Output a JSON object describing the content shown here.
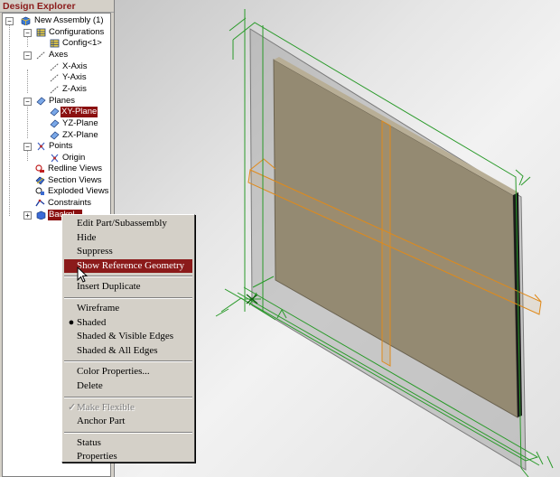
{
  "explorer": {
    "title": "Design Explorer",
    "tree": [
      {
        "label": "New Assembly (1)",
        "icon": "assembly-icon",
        "expander": "−",
        "selected": false
      },
      {
        "label": "Configurations",
        "icon": "configurations-icon",
        "expander": "−",
        "selected": false
      },
      {
        "label": "Config<1>",
        "icon": "config-icon",
        "selected": false
      },
      {
        "label": "Axes",
        "icon": "axes-icon",
        "expander": "−",
        "selected": false
      },
      {
        "label": "X-Axis",
        "icon": "axis-icon",
        "selected": false
      },
      {
        "label": "Y-Axis",
        "icon": "axis-icon",
        "selected": false
      },
      {
        "label": "Z-Axis",
        "icon": "axis-icon",
        "selected": false
      },
      {
        "label": "Planes",
        "icon": "planes-icon",
        "expander": "−",
        "selected": false
      },
      {
        "label": "XY-Plane",
        "icon": "plane-icon",
        "selected": true
      },
      {
        "label": "YZ-Plane",
        "icon": "plane-icon",
        "selected": false
      },
      {
        "label": "ZX-Plane",
        "icon": "plane-icon",
        "selected": false
      },
      {
        "label": "Points",
        "icon": "points-icon",
        "expander": "−",
        "selected": false
      },
      {
        "label": "Origin",
        "icon": "origin-icon",
        "selected": false
      },
      {
        "label": "Redline Views",
        "icon": "redline-views-icon",
        "selected": false
      },
      {
        "label": "Section Views",
        "icon": "section-views-icon",
        "selected": false
      },
      {
        "label": "Exploded Views",
        "icon": "exploded-views-icon",
        "selected": false
      },
      {
        "label": "Constraints",
        "icon": "constraints-icon",
        "selected": false
      },
      {
        "label": "Backpl...",
        "icon": "part-icon",
        "expander": "+",
        "selected": true
      }
    ]
  },
  "context_menu": {
    "items": [
      {
        "type": "item",
        "label": "Edit Part/Subassembly"
      },
      {
        "type": "item",
        "label": "Hide"
      },
      {
        "type": "item",
        "label": "Suppress"
      },
      {
        "type": "item",
        "label": "Show Reference Geometry",
        "highlighted": true
      },
      {
        "type": "separator"
      },
      {
        "type": "item",
        "label": "Insert Duplicate"
      },
      {
        "type": "separator"
      },
      {
        "type": "item",
        "label": "Wireframe"
      },
      {
        "type": "item",
        "label": "Shaded",
        "mark": "●"
      },
      {
        "type": "item",
        "label": "Shaded & Visible Edges"
      },
      {
        "type": "item",
        "label": "Shaded & All Edges"
      },
      {
        "type": "separator"
      },
      {
        "type": "item",
        "label": "Color Properties..."
      },
      {
        "type": "item",
        "label": "Delete"
      },
      {
        "type": "separator"
      },
      {
        "type": "item",
        "label": "Make Flexible",
        "mark": "✓",
        "disabled": true
      },
      {
        "type": "item",
        "label": "Anchor Part"
      },
      {
        "type": "separator"
      },
      {
        "type": "item",
        "label": "Status"
      },
      {
        "type": "item",
        "label": "Properties"
      }
    ]
  },
  "viewport": {
    "colors": {
      "plate_face": "#948a72",
      "plate_edge": "#1a1a1a",
      "ref_plane_fill": "#a8a8a8",
      "green_geometry": "#2a9a2a",
      "orange_geometry": "#e08a1a"
    }
  },
  "colors": {
    "highlight": "#8b1a1a",
    "panel_bg": "#d4d0c8"
  }
}
